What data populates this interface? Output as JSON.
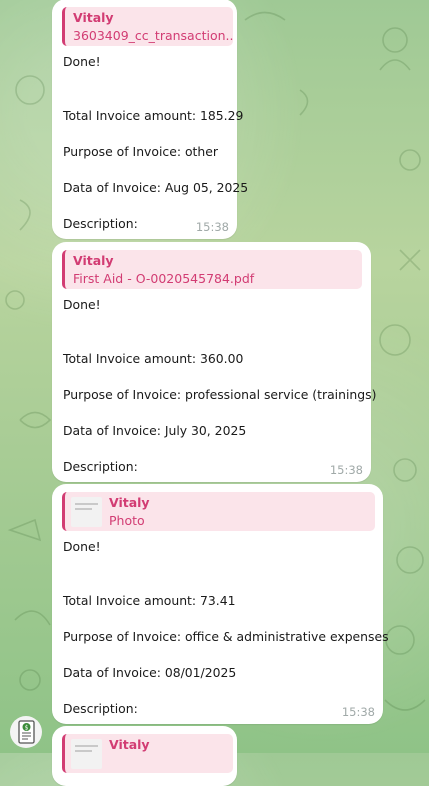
{
  "messages": [
    {
      "reply_name": "Vitaly",
      "reply_text": "3603409_cc_transaction....",
      "status": "Done!",
      "amount": "Total Invoice amount: 185.29",
      "purpose": "Purpose of Invoice: other",
      "date": "Data of Invoice: Aug 05, 2025",
      "description": "Description:",
      "time": "15:38"
    },
    {
      "reply_name": "Vitaly",
      "reply_text": "First Aid - O-0020545784.pdf",
      "status": "Done!",
      "amount": "Total Invoice amount: 360.00",
      "purpose": "Purpose of Invoice: professional service (trainings)",
      "date": "Data of Invoice: July 30, 2025",
      "description": "Description:",
      "time": "15:38"
    },
    {
      "reply_name": "Vitaly",
      "reply_text": "Photo",
      "status": "Done!",
      "amount": "Total Invoice amount: 73.41",
      "purpose": "Purpose of Invoice: office & administrative expenses",
      "date": "Data of Invoice: 08/01/2025",
      "description": "Description:",
      "time": "15:38"
    },
    {
      "reply_name": "Vitaly"
    }
  ],
  "colors": {
    "accent": "#d23c73",
    "reply_bg": "#fbe4ea",
    "time": "#a0a9a8",
    "bubble": "#ffffff"
  },
  "avatar_icon": "document-money-icon"
}
